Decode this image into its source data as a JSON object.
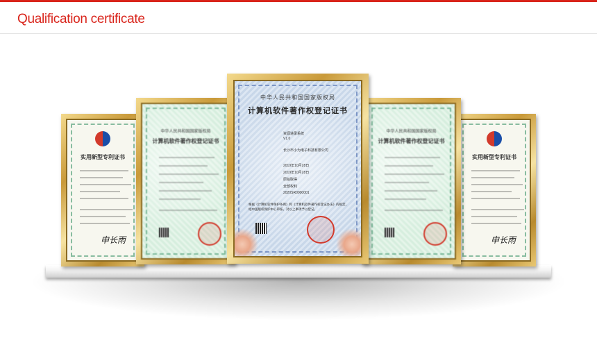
{
  "header": {
    "title": "Qualification certificate",
    "accent_color": "#d9241b"
  },
  "certificates": {
    "far_left": {
      "heading": "实用新型专利证书",
      "signature": "申长雨"
    },
    "left": {
      "line1": "中华人民共和国国家版权局",
      "heading": "计算机软件著作权登记证书"
    },
    "center": {
      "line1": "中华人民共和国国家版权局",
      "heading": "计算机软件著作权登记证书",
      "version": "V1.0",
      "software_name": "资源递录系统",
      "owner": "长沙市小为电子科技有限公司",
      "date_complete": "2019年10月28日",
      "date_publish": "2019年10月28日",
      "acquire": "原始取得",
      "scope": "全部权利",
      "reg_no": "2020SR0000001",
      "notice": "根据《计算机软件保护条例》和《计算机软件著作权登记办法》的规定，经中国版权保护中心审核，对以上事项予以登记。"
    },
    "right": {
      "line1": "中华人民共和国国家版权局",
      "heading": "计算机软件著作权登记证书"
    },
    "far_right": {
      "heading": "实用新型专利证书",
      "signature": "申长雨"
    }
  }
}
